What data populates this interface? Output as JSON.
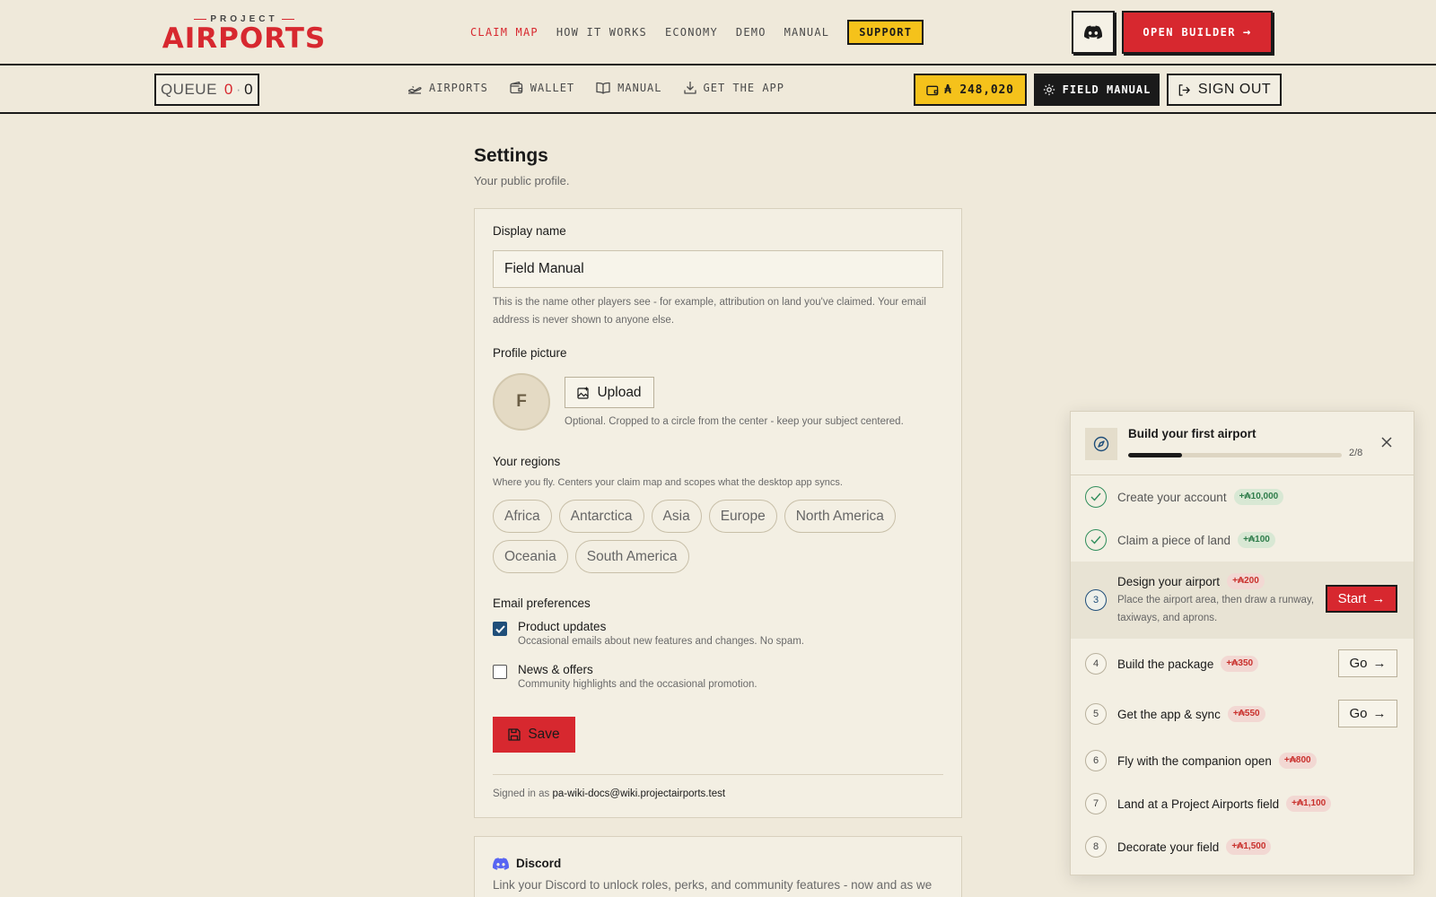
{
  "header": {
    "logo_top": "PROJECT",
    "logo_main": "AIRPORTS",
    "nav": [
      {
        "label": "CLAIM MAP",
        "active": true
      },
      {
        "label": "HOW IT WORKS",
        "active": false
      },
      {
        "label": "ECONOMY",
        "active": false
      },
      {
        "label": "DEMO",
        "active": false
      },
      {
        "label": "MANUAL",
        "active": false
      }
    ],
    "support_label": "SUPPORT",
    "discord_icon": "discord-icon",
    "open_builder_label": "OPEN BUILDER",
    "open_builder_arrow": "→"
  },
  "subbar": {
    "queue_label": "QUEUE",
    "queue_a": "0",
    "queue_sep": "·",
    "queue_b": "0",
    "links": [
      {
        "label": "AIRPORTS",
        "icon": "plane-takeoff-icon"
      },
      {
        "label": "WALLET",
        "icon": "wallet-icon"
      },
      {
        "label": "MANUAL",
        "icon": "book-icon"
      },
      {
        "label": "GET THE APP",
        "icon": "download-icon"
      }
    ],
    "balance": "₳ 248,020",
    "field_manual_label": "FIELD MANUAL",
    "sign_out_label": "SIGN OUT"
  },
  "main": {
    "title": "Settings",
    "subtitle": "Your public profile."
  },
  "profile": {
    "display_name_label": "Display name",
    "display_name_value": "Field Manual",
    "display_name_help": "This is the name other players see - for example, attribution on land you've claimed. Your email address is never shown to anyone else.",
    "picture_label": "Profile picture",
    "avatar_initial": "F",
    "upload_label": "Upload",
    "picture_help": "Optional. Cropped to a circle from the center - keep your subject centered.",
    "regions_label": "Your regions",
    "regions_help": "Where you fly. Centers your claim map and scopes what the desktop app syncs.",
    "regions_row1": [
      "Africa",
      "Antarctica",
      "Asia",
      "Europe",
      "North America"
    ],
    "regions_row2": [
      "Oceania",
      "South America"
    ],
    "email_label": "Email preferences",
    "email_options": [
      {
        "title": "Product updates",
        "desc": "Occasional emails about new features and changes. No spam.",
        "checked": true
      },
      {
        "title": "News & offers",
        "desc": "Community highlights and the occasional promotion.",
        "checked": false
      }
    ],
    "save_label": "Save",
    "signed_in_prefix": "Signed in as",
    "signed_in_email": "pa-wiki-docs@wiki.projectairports.test"
  },
  "discord": {
    "title": "Discord",
    "desc": "Link your Discord to unlock roles, perks, and community features - now and as we"
  },
  "onboarding": {
    "title": "Build your first airport",
    "progress": 0.25,
    "count": "2/8",
    "steps": [
      {
        "num": "1",
        "title": "Create your account",
        "reward": "+₳10,000",
        "state": "done"
      },
      {
        "num": "2",
        "title": "Claim a piece of land",
        "reward": "+₳100",
        "state": "done"
      },
      {
        "num": "3",
        "title": "Design your airport",
        "reward": "+₳200",
        "state": "current",
        "desc": "Place the airport area, then draw a runway, taxiways, and aprons.",
        "action": "Start"
      },
      {
        "num": "4",
        "title": "Build the package",
        "reward": "+₳350",
        "state": "todo",
        "action": "Go"
      },
      {
        "num": "5",
        "title": "Get the app & sync",
        "reward": "+₳550",
        "state": "todo",
        "action": "Go"
      },
      {
        "num": "6",
        "title": "Fly with the companion open",
        "reward": "+₳800",
        "state": "todo"
      },
      {
        "num": "7",
        "title": "Land at a Project Airports field",
        "reward": "+₳1,100",
        "state": "todo"
      },
      {
        "num": "8",
        "title": "Decorate your field",
        "reward": "+₳1,500",
        "state": "todo"
      }
    ]
  },
  "colors": {
    "accent_red": "#d7282f",
    "accent_yellow": "#f5c21b",
    "background": "#efe9da",
    "ink": "#1a1a1a"
  }
}
